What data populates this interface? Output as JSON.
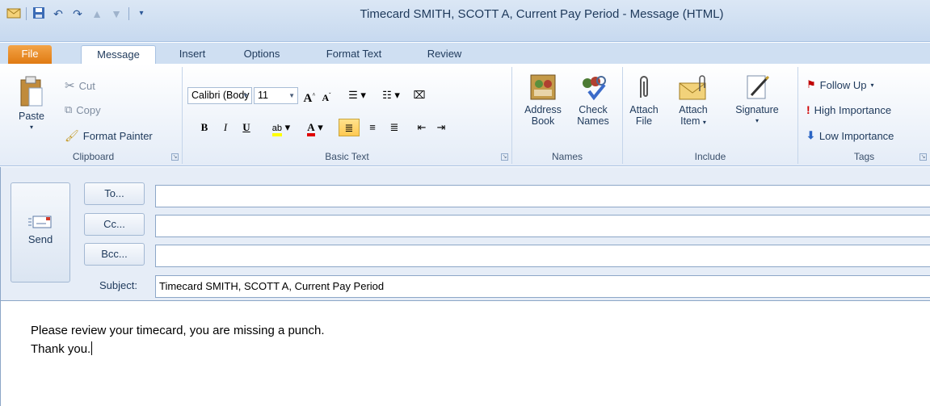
{
  "window": {
    "title": "Timecard SMITH, SCOTT A,  Current Pay Period  -  Message (HTML)"
  },
  "quick_access": {
    "icons": [
      "app-menu-icon",
      "save-icon",
      "undo-icon",
      "redo-icon",
      "up-arrow-icon",
      "down-arrow-icon",
      "customize-icon"
    ]
  },
  "tabs": [
    {
      "label": "File"
    },
    {
      "label": "Message"
    },
    {
      "label": "Insert"
    },
    {
      "label": "Options"
    },
    {
      "label": "Format Text"
    },
    {
      "label": "Review"
    }
  ],
  "ribbon": {
    "clipboard": {
      "label": "Clipboard",
      "paste": "Paste",
      "cut": "Cut",
      "copy": "Copy",
      "format_painter": "Format Painter"
    },
    "basic_text": {
      "label": "Basic Text",
      "font": "Calibri (Body",
      "size": "11"
    },
    "names": {
      "label": "Names",
      "address_book_1": "Address",
      "address_book_2": "Book",
      "check_names_1": "Check",
      "check_names_2": "Names"
    },
    "include": {
      "label": "Include",
      "attach_file_1": "Attach",
      "attach_file_2": "File",
      "attach_item_1": "Attach",
      "attach_item_2": "Item",
      "signature": "Signature"
    },
    "tags": {
      "label": "Tags",
      "follow_up": "Follow Up",
      "high": "High Importance",
      "low": "Low Importance"
    }
  },
  "header": {
    "send": "Send",
    "to": "To...",
    "cc": "Cc...",
    "bcc": "Bcc...",
    "subject_label": "Subject:",
    "subject_value": "Timecard SMITH, SCOTT A,  Current Pay Period"
  },
  "body": {
    "line1": "Please review your timecard, you are missing a punch.",
    "line2": "Thank you."
  },
  "colors": {
    "file_tab": "#e07a12",
    "ribbon_border": "#a8c2e2",
    "active_format": "#ffc951"
  }
}
